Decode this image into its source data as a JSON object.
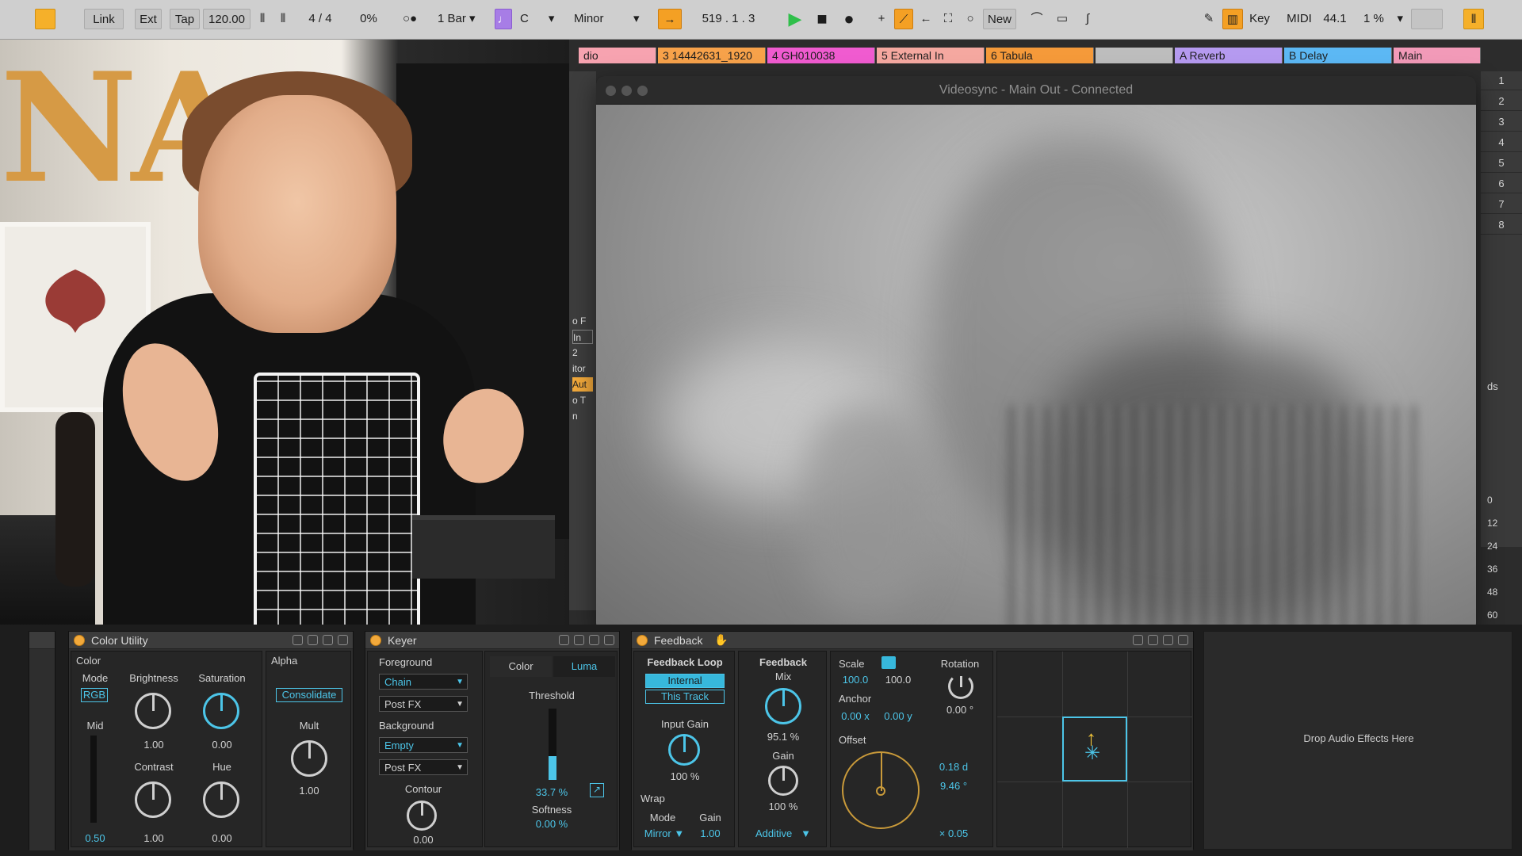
{
  "transport": {
    "link": "Link",
    "ext": "Ext",
    "tap": "Tap",
    "tempo": "120.00",
    "time_sig": "4 / 4",
    "groove": "0%",
    "quantize": "1 Bar",
    "key_root": "C",
    "scale": "Minor",
    "position": "519 .   1 .   3",
    "new": "New",
    "key_map": "Key",
    "midi_map": "MIDI",
    "sample_rate": "44.1",
    "cpu": "1 %"
  },
  "tracks": [
    {
      "name": "dio",
      "color": "#f7a3b0"
    },
    {
      "name": "3 14442631_1920",
      "color": "#f7a24a"
    },
    {
      "name": "4 GH010038",
      "color": "#f05bd0"
    },
    {
      "name": "5 External In",
      "color": "#f5a8a0"
    },
    {
      "name": "6 Tabula",
      "color": "#f59a3a"
    },
    {
      "name": "",
      "color": "#bdbdbd"
    },
    {
      "name": "A Reverb",
      "color": "#b59af0"
    },
    {
      "name": "B Delay",
      "color": "#5cb8f4"
    },
    {
      "name": "Main",
      "color": "#f29ab8"
    }
  ],
  "scenes": [
    "1",
    "2",
    "3",
    "4",
    "5",
    "6",
    "7",
    "8"
  ],
  "left_strip": [
    "o F",
    "In",
    "2",
    "itor",
    "Aut",
    "o T",
    "n"
  ],
  "meter_labels": [
    "0",
    "12",
    "24",
    "36",
    "48",
    "60"
  ],
  "right_strip_label": "ds",
  "videosync": {
    "title": "Videosync - Main Out - Connected"
  },
  "color_utility": {
    "name": "Color Utility",
    "color_section": "Color",
    "alpha_section": "Alpha",
    "mode_label": "Mode",
    "mode_value": "RGB",
    "brightness_label": "Brightness",
    "brightness_value": "1.00",
    "saturation_label": "Saturation",
    "saturation_value": "0.00",
    "mid_label": "Mid",
    "mid_value": "0.50",
    "contrast_label": "Contrast",
    "contrast_value": "1.00",
    "hue_label": "Hue",
    "hue_value": "0.00",
    "consolidate_label": "Consolidate",
    "mult_label": "Mult",
    "mult_value": "1.00"
  },
  "keyer": {
    "name": "Keyer",
    "foreground_label": "Foreground",
    "foreground_value": "Chain",
    "fg_fx": "Post FX",
    "background_label": "Background",
    "background_value": "Empty",
    "bg_fx": "Post FX",
    "contour_label": "Contour",
    "contour_value": "0.00",
    "tab_color": "Color",
    "tab_luma": "Luma",
    "threshold_label": "Threshold",
    "threshold_value": "33.7 %",
    "threshold_level": 0.337,
    "softness_label": "Softness",
    "softness_value": "0.00 %"
  },
  "feedback": {
    "name": "Feedback",
    "loop_label": "Feedback Loop",
    "internal": "Internal",
    "this_track": "This Track",
    "input_gain_label": "Input Gain",
    "input_gain_value": "100 %",
    "wrap_label": "Wrap",
    "wrap_mode_label": "Mode",
    "wrap_mode_value": "Mirror",
    "wrap_gain_label": "Gain",
    "wrap_gain_value": "1.00",
    "feedback_label": "Feedback",
    "mix_label": "Mix",
    "mix_value": "95.1 %",
    "gain_label": "Gain",
    "gain_value": "100 %",
    "blend_value": "Additive",
    "scale_label": "Scale",
    "scale_x": "100.0",
    "scale_y": "100.0",
    "rotation_label": "Rotation",
    "rotation_value": "0.00 °",
    "anchor_label": "Anchor",
    "anchor_x": "0.00 x",
    "anchor_y": "0.00 y",
    "offset_label": "Offset",
    "offset_d": "0.18 d",
    "offset_angle": "9.46 °",
    "offset_mult": "× 0.05"
  },
  "drop_area": "Drop Audio Effects Here",
  "colors": {
    "accent_blue": "#4cc5e8",
    "power_orange": "#f2a93b",
    "play_green": "#2fbf4a"
  }
}
